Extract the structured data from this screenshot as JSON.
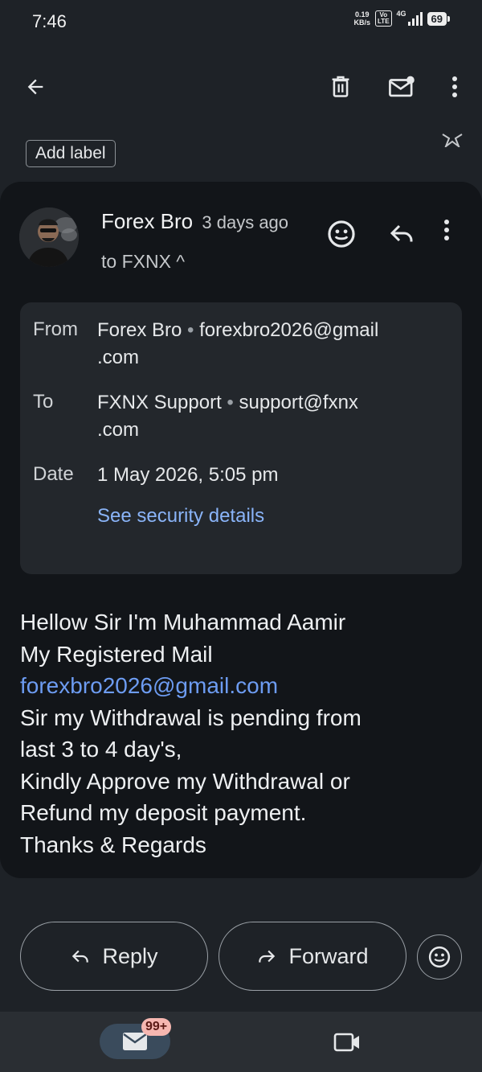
{
  "status_bar": {
    "time": "7:46",
    "net_speed_value": "0.19",
    "net_speed_unit": "KB/s",
    "volte_top": "Vo",
    "volte_bottom": "LTE",
    "network_type": "4G",
    "battery": "69"
  },
  "app_bar": {
    "back_icon": "arrow-left-icon",
    "delete_icon": "trash-icon",
    "mark_unread_icon": "mail-unread-icon",
    "more_icon": "more-vert-icon"
  },
  "label_row": {
    "add_label": "Add label",
    "star_icon": "star-outline-icon"
  },
  "email": {
    "sender": "Forex Bro",
    "time": "3 days ago",
    "recipient_line": "to FXNX ^",
    "details": {
      "from_label": "From",
      "from_name": "Forex Bro",
      "from_email": "forexbro2026@gmail.com",
      "from_email_line1": "forexbro2026@gmail",
      "from_email_line2": ".com",
      "to_label": "To",
      "to_name": "FXNX Support",
      "to_email_line1": "support@fxnx",
      "to_email_line2": ".com",
      "date_label": "Date",
      "date_value": "1 May 2026, 5:05 pm",
      "security_link": "See security details"
    },
    "body_lines": [
      "Hellow Sir I'm Muhammad Aamir",
      "My Registered Mail",
      "forexbro2026@gmail.com",
      "Sir my Withdrawal is pending from",
      "last 3 to 4 day's,",
      "Kindly Approve my Withdrawal or",
      "Refund my deposit payment.",
      "Thanks & Regards"
    ]
  },
  "actions": {
    "reply": "Reply",
    "forward": "Forward"
  },
  "bottom_nav": {
    "mail_badge": "99+"
  },
  "colors": {
    "background": "#1e2227",
    "card": "#121519",
    "details_box": "#23272c",
    "link": "#8ab4f8",
    "body_link": "#6d9cf2",
    "badge": "#f6b7b1",
    "active_tab": "#3a4b5c"
  }
}
